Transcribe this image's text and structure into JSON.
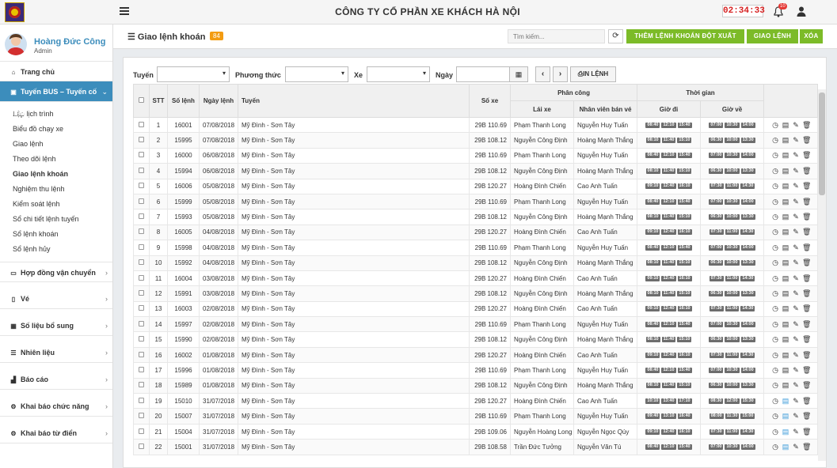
{
  "header": {
    "company": "CÔNG TY CỔ PHẦN XE KHÁCH HÀ NỘI",
    "clock": "02:34:33",
    "notif_count": "10"
  },
  "user": {
    "name": "Hoàng Đức Công",
    "role": "Admin"
  },
  "sidebar": {
    "home": "Trang chủ",
    "active_section": "Tuyến BUS – Tuyến cố định",
    "subitems": [
      "Lập lịch trình",
      "Biểu đồ chạy xe",
      "Giao lệnh",
      "Theo dõi lệnh",
      "Giao lệnh khoán",
      "Nghiệm thu lệnh",
      "Kiểm soát lệnh",
      "Sổ chi tiết lệnh tuyến",
      "Sổ lệnh khoán",
      "Sổ lệnh hủy"
    ],
    "sections": [
      "Hợp đồng vận chuyển",
      "Vé",
      "Số liệu bổ sung",
      "Nhiên liệu",
      "Báo cáo",
      "Khai báo chức năng",
      "Khai báo từ điển"
    ]
  },
  "page": {
    "title": "Giao lệnh khoán",
    "count": "84",
    "search_placeholder": "Tìm kiếm...",
    "btn_add": "THÊM LỆNH KHOÁN ĐỘT XUẤT",
    "btn_assign": "GIAO LỆNH",
    "btn_delete": "XÓA"
  },
  "filters": {
    "route": "Tuyến",
    "method": "Phương thức",
    "vehicle": "Xe",
    "date": "Ngày",
    "print": "IN LỆNH"
  },
  "table": {
    "headers": {
      "stt": "STT",
      "order_no": "Số lệnh",
      "order_date": "Ngày lệnh",
      "route": "Tuyến",
      "plate": "Số xe",
      "assign": "Phân công",
      "driver": "Lái xe",
      "seller": "Nhân viên bán vé",
      "time": "Thời gian",
      "depart": "Giờ đi",
      "return": "Giờ về"
    },
    "rows": [
      [
        "1",
        "16001",
        "07/08/2018",
        "Mỹ Đình - Sơn Tây",
        "29B 110.69",
        "Phạm Thanh Long",
        "Nguyễn Huy Tuấn",
        [
          "08:40",
          "12:10",
          "15:40"
        ],
        [
          "07:00",
          "10:30",
          "14:00"
        ]
      ],
      [
        "2",
        "15995",
        "07/08/2018",
        "Mỹ Đình - Sơn Tây",
        "29B 108.12",
        "Nguyễn Công Định",
        "Hoàng Mạnh Thắng",
        [
          "08:10",
          "11:40",
          "15:10"
        ],
        [
          "06:30",
          "10:00",
          "13:30"
        ]
      ],
      [
        "3",
        "16000",
        "06/08/2018",
        "Mỹ Đình - Sơn Tây",
        "29B 110.69",
        "Phạm Thanh Long",
        "Nguyễn Huy Tuấn",
        [
          "08:40",
          "12:10",
          "15:40"
        ],
        [
          "07:00",
          "10:30",
          "14:00"
        ]
      ],
      [
        "4",
        "15994",
        "06/08/2018",
        "Mỹ Đình - Sơn Tây",
        "29B 108.12",
        "Nguyễn Công Định",
        "Hoàng Mạnh Thắng",
        [
          "08:10",
          "11:40",
          "15:10"
        ],
        [
          "06:30",
          "10:00",
          "13:30"
        ]
      ],
      [
        "5",
        "16006",
        "05/08/2018",
        "Mỹ Đình - Sơn Tây",
        "29B 120.27",
        "Hoàng Đình Chiến",
        "Cao Anh Tuấn",
        [
          "09:10",
          "12:40",
          "16:10"
        ],
        [
          "07:30",
          "11:00",
          "14:30"
        ]
      ],
      [
        "6",
        "15999",
        "05/08/2018",
        "Mỹ Đình - Sơn Tây",
        "29B 110.69",
        "Phạm Thanh Long",
        "Nguyễn Huy Tuấn",
        [
          "08:40",
          "12:10",
          "15:40"
        ],
        [
          "07:00",
          "10:30",
          "14:00"
        ]
      ],
      [
        "7",
        "15993",
        "05/08/2018",
        "Mỹ Đình - Sơn Tây",
        "29B 108.12",
        "Nguyễn Công Định",
        "Hoàng Mạnh Thắng",
        [
          "08:10",
          "11:40",
          "15:10"
        ],
        [
          "06:30",
          "10:00",
          "13:30"
        ]
      ],
      [
        "8",
        "16005",
        "04/08/2018",
        "Mỹ Đình - Sơn Tây",
        "29B 120.27",
        "Hoàng Đình Chiến",
        "Cao Anh Tuấn",
        [
          "09:10",
          "12:40",
          "16:10"
        ],
        [
          "07:30",
          "11:00",
          "14:30"
        ]
      ],
      [
        "9",
        "15998",
        "04/08/2018",
        "Mỹ Đình - Sơn Tây",
        "29B 110.69",
        "Phạm Thanh Long",
        "Nguyễn Huy Tuấn",
        [
          "08:40",
          "12:10",
          "15:40"
        ],
        [
          "07:00",
          "10:30",
          "14:00"
        ]
      ],
      [
        "10",
        "15992",
        "04/08/2018",
        "Mỹ Đình - Sơn Tây",
        "29B 108.12",
        "Nguyễn Công Định",
        "Hoàng Mạnh Thắng",
        [
          "08:10",
          "11:40",
          "15:10"
        ],
        [
          "06:30",
          "10:00",
          "13:30"
        ]
      ],
      [
        "11",
        "16004",
        "03/08/2018",
        "Mỹ Đình - Sơn Tây",
        "29B 120.27",
        "Hoàng Đình Chiến",
        "Cao Anh Tuấn",
        [
          "09:10",
          "12:40",
          "16:10"
        ],
        [
          "07:30",
          "11:00",
          "14:30"
        ]
      ],
      [
        "12",
        "15991",
        "03/08/2018",
        "Mỹ Đình - Sơn Tây",
        "29B 108.12",
        "Nguyễn Công Định",
        "Hoàng Mạnh Thắng",
        [
          "08:10",
          "11:40",
          "15:10"
        ],
        [
          "06:30",
          "10:00",
          "13:30"
        ]
      ],
      [
        "13",
        "16003",
        "02/08/2018",
        "Mỹ Đình - Sơn Tây",
        "29B 120.27",
        "Hoàng Đình Chiến",
        "Cao Anh Tuấn",
        [
          "09:10",
          "12:40",
          "16:10"
        ],
        [
          "07:30",
          "11:00",
          "14:30"
        ]
      ],
      [
        "14",
        "15997",
        "02/08/2018",
        "Mỹ Đình - Sơn Tây",
        "29B 110.69",
        "Phạm Thanh Long",
        "Nguyễn Huy Tuấn",
        [
          "08:40",
          "12:10",
          "15:40"
        ],
        [
          "07:00",
          "10:30",
          "14:00"
        ]
      ],
      [
        "15",
        "15990",
        "02/08/2018",
        "Mỹ Đình - Sơn Tây",
        "29B 108.12",
        "Nguyễn Công Định",
        "Hoàng Mạnh Thắng",
        [
          "08:10",
          "11:40",
          "15:10"
        ],
        [
          "06:30",
          "10:00",
          "13:30"
        ]
      ],
      [
        "16",
        "16002",
        "01/08/2018",
        "Mỹ Đình - Sơn Tây",
        "29B 120.27",
        "Hoàng Đình Chiến",
        "Cao Anh Tuấn",
        [
          "09:10",
          "12:40",
          "16:10"
        ],
        [
          "07:30",
          "11:00",
          "14:30"
        ]
      ],
      [
        "17",
        "15996",
        "01/08/2018",
        "Mỹ Đình - Sơn Tây",
        "29B 110.69",
        "Phạm Thanh Long",
        "Nguyễn Huy Tuấn",
        [
          "08:40",
          "12:10",
          "15:40"
        ],
        [
          "07:00",
          "10:30",
          "14:00"
        ]
      ],
      [
        "18",
        "15989",
        "01/08/2018",
        "Mỹ Đình - Sơn Tây",
        "29B 108.12",
        "Nguyễn Công Định",
        "Hoàng Mạnh Thắng",
        [
          "08:10",
          "11:40",
          "15:10"
        ],
        [
          "06:30",
          "10:00",
          "13:30"
        ]
      ],
      [
        "19",
        "15010",
        "31/07/2018",
        "Mỹ Đình - Sơn Tây",
        "29B 120.27",
        "Hoàng Đình Chiến",
        "Cao Anh Tuấn",
        [
          "10:10",
          "13:40",
          "17:10"
        ],
        [
          "08:30",
          "12:00",
          "15:30"
        ]
      ],
      [
        "20",
        "15007",
        "31/07/2018",
        "Mỹ Đình - Sơn Tây",
        "29B 110.69",
        "Phạm Thanh Long",
        "Nguyễn Huy Tuấn",
        [
          "09:40",
          "13:10",
          "16:40"
        ],
        [
          "08:00",
          "11:30",
          "15:00"
        ]
      ],
      [
        "21",
        "15004",
        "31/07/2018",
        "Mỹ Đình - Sơn Tây",
        "29B 109.06",
        "Nguyễn Hoàng Long",
        "Nguyễn Ngọc Qúy",
        [
          "09:10",
          "12:40",
          "16:10"
        ],
        [
          "07:30",
          "11:00",
          "14:30"
        ]
      ],
      [
        "22",
        "15001",
        "31/07/2018",
        "Mỹ Đình - Sơn Tây",
        "29B 108.58",
        "Trần Đức Tưởng",
        "Nguyễn Văn Tú",
        [
          "08:40",
          "12:10",
          "15:40"
        ],
        [
          "07:00",
          "10:30",
          "14:00"
        ]
      ]
    ]
  }
}
